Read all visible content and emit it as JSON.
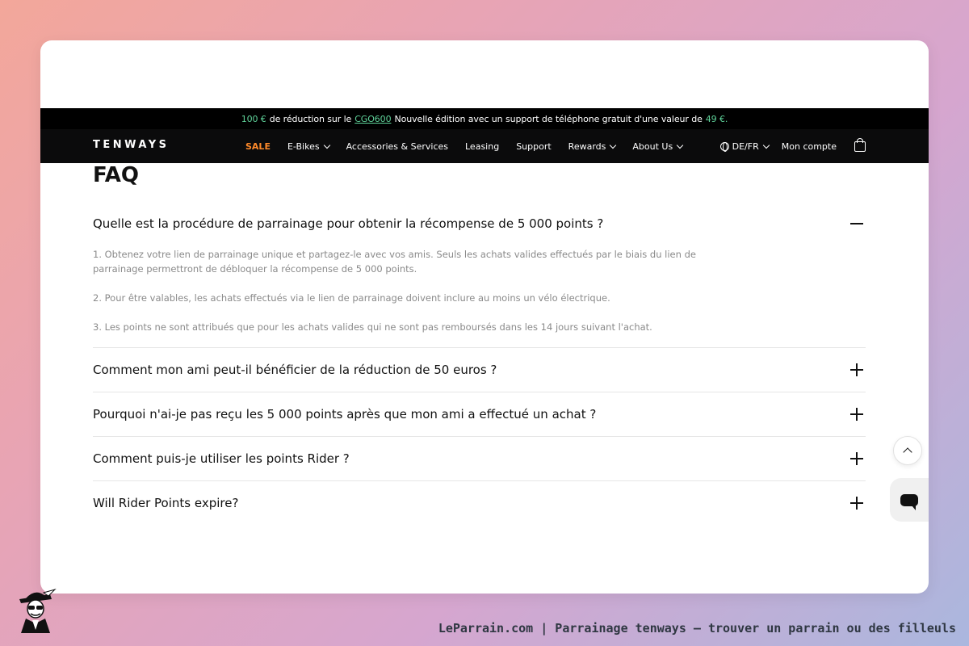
{
  "promo": {
    "amount": "100 €",
    "text1": "de réduction sur le",
    "code": "CGO600",
    "text2": "Nouvelle édition avec un support de téléphone gratuit d'une valeur de",
    "value": "49 €",
    "text3": "."
  },
  "nav": {
    "logo": "TENWAYS",
    "sale": "SALE",
    "ebikes": "E-Bikes",
    "accessories": "Accessories & Services",
    "leasing": "Leasing",
    "support": "Support",
    "rewards": "Rewards",
    "about": "About Us",
    "locale": "DE/FR",
    "account": "Mon compte",
    "icons": [
      "chevron-down-icon",
      "globe-icon",
      "bag-icon"
    ]
  },
  "faq": {
    "title": "FAQ",
    "items": [
      {
        "question": "Quelle est la procédure de parrainage pour obtenir la récompense de 5 000 points ?",
        "open": true,
        "answers": [
          "1. Obtenez votre lien de parrainage unique et partagez-le avec vos amis. Seuls les achats valides effectués par le biais du lien de parrainage permettront de débloquer la récompense de 5 000 points.",
          "2. Pour être valables, les achats effectués via le lien de parrainage doivent inclure au moins un vélo électrique.",
          "3. Les points ne sont attribués que pour les achats valides qui ne sont pas remboursés dans les 14 jours suivant l'achat."
        ]
      },
      {
        "question": "Comment mon ami peut-il bénéficier de la réduction de 50 euros ?",
        "open": false
      },
      {
        "question": "Pourquoi n'ai-je pas reçu les 5 000 points après que mon ami a effectué un achat ?",
        "open": false
      },
      {
        "question": "Comment puis-je utiliser les points Rider ?",
        "open": false
      },
      {
        "question": "Will Rider Points expire?",
        "open": false
      }
    ]
  },
  "footer": {
    "caption": "LeParrain.com | Parrainage tenways — trouver un parrain ou des filleuls"
  },
  "colors": {
    "accent_green": "#5fd39a",
    "sale_orange": "#ff8a2a",
    "nav_bg": "#0b0b0c"
  }
}
